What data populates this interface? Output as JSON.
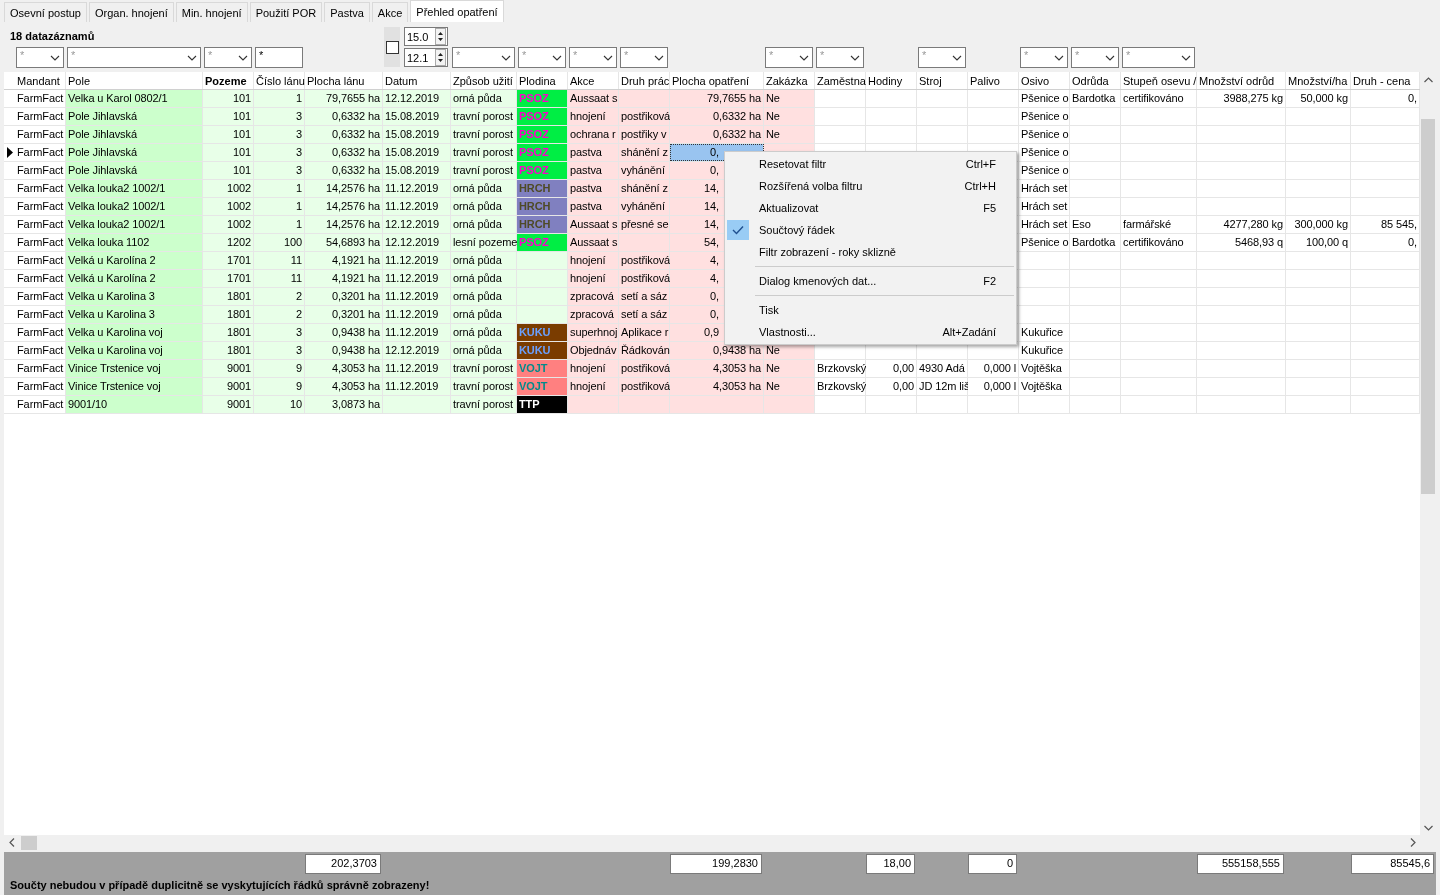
{
  "tabs": [
    {
      "label": "Osevní postup",
      "selected": false
    },
    {
      "label": "Organ. hnojení",
      "selected": false
    },
    {
      "label": "Min. hnojení",
      "selected": false
    },
    {
      "label": "Použití POR",
      "selected": false
    },
    {
      "label": "Pastva",
      "selected": false
    },
    {
      "label": "Akce",
      "selected": false
    },
    {
      "label": "Přehled opatření",
      "selected": true
    }
  ],
  "grid": {
    "record_count": "18 datazáznamů",
    "columns": [
      {
        "label": "Mandant",
        "kind": "text",
        "color": "#ffffff",
        "sorted": false,
        "focused": false,
        "filter": {
          "kind": "dropdown",
          "value": "*"
        }
      },
      {
        "label": "Pole",
        "kind": "text",
        "color": "#ccffcc",
        "sorted": false,
        "focused": false,
        "filter": {
          "kind": "dropdown",
          "value": "*"
        }
      },
      {
        "label": "Pozeme",
        "kind": "number",
        "color": "#e8ffe8",
        "sorted": true,
        "focused": false,
        "filter": {
          "kind": "dropdown",
          "value": "*"
        }
      },
      {
        "label": "Číslo lánu",
        "kind": "number",
        "color": "#e8ffe8",
        "sorted": false,
        "focused": false,
        "filter": {
          "kind": "text",
          "value": "*"
        }
      },
      {
        "label": "Plocha lánu",
        "kind": "number",
        "color": "#e8ffe8",
        "sorted": false,
        "focused": false,
        "total": "202,3703"
      },
      {
        "label": "Datum",
        "kind": "text",
        "color": "#e8ffe8",
        "sorted": false,
        "focused": false,
        "filter": {
          "kind": "date_range",
          "checked": false,
          "from": "15.0",
          "to": "12.1"
        }
      },
      {
        "label": "Způsob užití",
        "kind": "text",
        "color": "#e8ffe8",
        "sorted": false,
        "focused": false,
        "filter": {
          "kind": "dropdown",
          "value": "*"
        }
      },
      {
        "label": "Plodina",
        "kind": "tag",
        "color": "#e8ffe8",
        "sorted": false,
        "focused": false,
        "filter": {
          "kind": "dropdown",
          "value": "*"
        }
      },
      {
        "label": "Akce",
        "kind": "text",
        "color": "#ffe0e0",
        "sorted": false,
        "focused": false,
        "filter": {
          "kind": "dropdown",
          "value": "*"
        }
      },
      {
        "label": "Druh prác",
        "kind": "text",
        "color": "#ffe0e0",
        "sorted": false,
        "focused": false,
        "filter": {
          "kind": "dropdown",
          "value": "*"
        }
      },
      {
        "label": "Plocha opatření",
        "kind": "number",
        "color": "#ffe0e0",
        "sorted": false,
        "focused": true,
        "total": "199,2830"
      },
      {
        "label": "Zakázka",
        "kind": "text",
        "color": "#ffe0e0",
        "sorted": false,
        "focused": false,
        "filter": {
          "kind": "dropdown",
          "value": "*"
        }
      },
      {
        "label": "Zaměstna",
        "kind": "text",
        "color": "#ffffff",
        "sorted": false,
        "focused": false,
        "filter": {
          "kind": "dropdown",
          "value": "*"
        }
      },
      {
        "label": "Hodiny",
        "kind": "number",
        "color": "#ffffff",
        "sorted": false,
        "focused": false,
        "total": "18,00"
      },
      {
        "label": "Stroj",
        "kind": "text",
        "color": "#ffffff",
        "sorted": false,
        "focused": false,
        "filter": {
          "kind": "dropdown",
          "value": "*"
        }
      },
      {
        "label": "Palivo",
        "kind": "number",
        "color": "#ffffff",
        "sorted": false,
        "focused": false,
        "total": "0"
      },
      {
        "label": "Osivo",
        "kind": "text",
        "color": "#ffffff",
        "sorted": false,
        "focused": false,
        "filter": {
          "kind": "dropdown",
          "value": "*"
        }
      },
      {
        "label": "Odrůda",
        "kind": "text",
        "color": "#ffffff",
        "sorted": false,
        "focused": false,
        "filter": {
          "kind": "dropdown",
          "value": "*"
        }
      },
      {
        "label": "Stupeň osevu /",
        "kind": "text",
        "color": "#ffffff",
        "sorted": false,
        "focused": false,
        "filter": {
          "kind": "dropdown",
          "value": "*"
        }
      },
      {
        "label": "Množství odrůd",
        "kind": "number",
        "color": "#ffffff",
        "sorted": false,
        "focused": false,
        "total": "555158,555"
      },
      {
        "label": "Množství/ha",
        "kind": "number",
        "color": "#ffffff",
        "sorted": false,
        "focused": false
      },
      {
        "label": "Druh - cena",
        "kind": "number",
        "color": "#ffffff",
        "sorted": false,
        "focused": false,
        "total": "85545,6"
      }
    ],
    "rows": [
      {
        "selected": false,
        "under_menu": false,
        "cells": [
          "FarmFact",
          "Velka u Karol 0802/1",
          "101",
          "1",
          "79,7655 ha",
          "12.12.2019",
          "orná půda",
          {
            "color": "#00ee44",
            "code": {
              "text": "PSOZ",
              "color": "#ff00cc"
            }
          },
          "Aussaat s",
          null,
          "79,7655 ha",
          "Ne",
          null,
          null,
          null,
          null,
          "Pšenice o",
          "Bardotka",
          "certifikováno",
          "3988,275 kg",
          "50,000 kg",
          "0,"
        ]
      },
      {
        "selected": false,
        "under_menu": false,
        "cells": [
          "FarmFact",
          "Pole Jihlavská",
          "101",
          "3",
          "0,6332 ha",
          "15.08.2019",
          "travní porost",
          {
            "color": "#00ee44",
            "code": {
              "text": "PSOZ",
              "color": "#ff00cc"
            }
          },
          "hnojení",
          "postřiková",
          "0,6332 ha",
          "Ne",
          null,
          null,
          null,
          null,
          "Pšenice o",
          null,
          null,
          null,
          null,
          null
        ]
      },
      {
        "selected": false,
        "under_menu": false,
        "cells": [
          "FarmFact",
          "Pole Jihlavská",
          "101",
          "3",
          "0,6332 ha",
          "15.08.2019",
          "travní porost",
          {
            "color": "#00ee44",
            "code": {
              "text": "PSOZ",
              "color": "#ff00cc"
            }
          },
          "ochrana r",
          "postřiky v",
          "0,6332 ha",
          "Ne",
          null,
          null,
          null,
          null,
          "Pšenice o",
          null,
          null,
          null,
          null,
          null
        ]
      },
      {
        "selected": true,
        "under_menu": true,
        "cells": [
          "FarmFact",
          "Pole Jihlavská",
          "101",
          "3",
          "0,6332 ha",
          "15.08.2019",
          "travní porost",
          {
            "color": "#00ee44",
            "code": {
              "text": "PSOZ",
              "color": "#ff00cc"
            }
          },
          "pastva",
          "shánění z",
          "0,",
          null,
          null,
          null,
          null,
          null,
          "Pšenice o",
          null,
          null,
          null,
          null,
          null
        ]
      },
      {
        "selected": false,
        "under_menu": true,
        "cells": [
          "FarmFact",
          "Pole Jihlavská",
          "101",
          "3",
          "0,6332 ha",
          "15.08.2019",
          "travní porost",
          {
            "color": "#00ee44",
            "code": {
              "text": "PSOZ",
              "color": "#ff00cc"
            }
          },
          "pastva",
          "vyhánění",
          "0,",
          null,
          null,
          null,
          null,
          null,
          "Pšenice o",
          null,
          null,
          null,
          null,
          null
        ]
      },
      {
        "selected": false,
        "under_menu": true,
        "cells": [
          "FarmFact",
          "Velka louka2 1002/1",
          "1002",
          "1",
          "14,2576 ha",
          "11.12.2019",
          "orná půda",
          {
            "color": "#8080c0",
            "code": {
              "text": "HRCH",
              "color": "#4e4a26"
            }
          },
          "pastva",
          "shánění z",
          "14,",
          null,
          null,
          null,
          null,
          null,
          "Hrách set",
          null,
          null,
          null,
          null,
          null
        ]
      },
      {
        "selected": false,
        "under_menu": true,
        "cells": [
          "FarmFact",
          "Velka louka2 1002/1",
          "1002",
          "1",
          "14,2576 ha",
          "11.12.2019",
          "orná půda",
          {
            "color": "#8080c0",
            "code": {
              "text": "HRCH",
              "color": "#4e4a26"
            }
          },
          "pastva",
          "vyhánění",
          "14,",
          null,
          null,
          null,
          null,
          null,
          "Hrách set",
          null,
          null,
          null,
          null,
          null
        ]
      },
      {
        "selected": false,
        "under_menu": true,
        "cells": [
          "FarmFact",
          "Velka louka2 1002/1",
          "1002",
          "1",
          "14,2576 ha",
          "12.12.2019",
          "orná půda",
          {
            "color": "#8080c0",
            "code": {
              "text": "HRCH",
              "color": "#4e4a26"
            }
          },
          "Aussaat s",
          "přesné se",
          "14,",
          null,
          null,
          null,
          null,
          null,
          "Hrách set",
          "Eso",
          "farmářské",
          "4277,280 kg",
          "300,000 kg",
          "85 545,"
        ]
      },
      {
        "selected": false,
        "under_menu": true,
        "cells": [
          "FarmFact",
          "Velka louka 1102",
          "1202",
          "100",
          "54,6893 ha",
          "12.12.2019",
          "lesní pozeme",
          {
            "color": "#00ee44",
            "code": {
              "text": "PSOZ",
              "color": "#ff00cc"
            }
          },
          "Aussaat s",
          null,
          "54,",
          null,
          null,
          null,
          null,
          null,
          "Pšenice o",
          "Bardotka",
          "certifikováno",
          "5468,93 q",
          "100,00 q",
          "0,"
        ]
      },
      {
        "selected": false,
        "under_menu": true,
        "cells": [
          "FarmFact",
          "Velká u Karolína 2",
          "1701",
          "11",
          "4,1921 ha",
          "11.12.2019",
          "orná půda",
          null,
          "hnojení",
          "postřiková",
          "4,",
          null,
          null,
          null,
          null,
          null,
          null,
          null,
          null,
          null,
          null,
          null
        ]
      },
      {
        "selected": false,
        "under_menu": true,
        "cells": [
          "FarmFact",
          "Velká u Karolína 2",
          "1701",
          "11",
          "4,1921 ha",
          "11.12.2019",
          "orná půda",
          null,
          "hnojení",
          "postřiková",
          "4,",
          null,
          null,
          null,
          null,
          null,
          null,
          null,
          null,
          null,
          null,
          null
        ]
      },
      {
        "selected": false,
        "under_menu": true,
        "cells": [
          "FarmFact",
          "Velka u Karolina 3",
          "1801",
          "2",
          "0,3201 ha",
          "11.12.2019",
          "orná půda",
          null,
          "zpracová",
          "setí a sáz",
          "0,",
          null,
          null,
          null,
          null,
          null,
          null,
          null,
          null,
          null,
          null,
          null
        ]
      },
      {
        "selected": false,
        "under_menu": true,
        "cells": [
          "FarmFact",
          "Velka u Karolina 3",
          "1801",
          "2",
          "0,3201 ha",
          "11.12.2019",
          "orná půda",
          null,
          "zpracová",
          "setí a sáz",
          "0,",
          null,
          null,
          null,
          null,
          null,
          null,
          null,
          null,
          null,
          null,
          null
        ]
      },
      {
        "selected": false,
        "under_menu": true,
        "cells": [
          "FarmFact",
          "Velka u Karolina voj",
          "1801",
          "3",
          "0,9438 ha",
          "11.12.2019",
          "orná půda",
          {
            "color": "#7a3c00",
            "code": {
              "text": "KUKU",
              "color": "#6aa0ff"
            }
          },
          "superhnoj",
          "Aplikace r",
          "0,9",
          null,
          null,
          null,
          null,
          null,
          "Kukuřice",
          null,
          null,
          null,
          null,
          null
        ]
      },
      {
        "selected": false,
        "under_menu": false,
        "cells": [
          "FarmFact",
          "Velka u Karolina voj",
          "1801",
          "3",
          "0,9438 ha",
          "12.12.2019",
          "orná půda",
          {
            "color": "#7a3c00",
            "code": {
              "text": "KUKU",
              "color": "#6aa0ff"
            }
          },
          "Objednáv",
          "Řádkován",
          "0,9438 ha",
          "Ne",
          null,
          null,
          null,
          null,
          "Kukuřice",
          null,
          null,
          null,
          null,
          null
        ]
      },
      {
        "selected": false,
        "under_menu": false,
        "cells": [
          "FarmFact",
          "Vinice Trstenice voj",
          "9001",
          "9",
          "4,3053 ha",
          "11.12.2019",
          "travní porost",
          {
            "color": "#ff8080",
            "code": {
              "text": "VOJT",
              "color": "#008b8b"
            }
          },
          "hnojení",
          "postřiková",
          "4,3053 ha",
          "Ne",
          "Brzkovský",
          "0,00",
          "4930 Adá",
          "0,000 l",
          "Vojtěška",
          null,
          null,
          null,
          null,
          null
        ]
      },
      {
        "selected": false,
        "under_menu": false,
        "cells": [
          "FarmFact",
          "Vinice Trstenice voj",
          "9001",
          "9",
          "4,3053 ha",
          "11.12.2019",
          "travní porost",
          {
            "color": "#ff8080",
            "code": {
              "text": "VOJT",
              "color": "#008b8b"
            }
          },
          "hnojení",
          "postřiková",
          "4,3053 ha",
          "Ne",
          "Brzkovský",
          "0,00",
          "JD 12m liš",
          "0,000 l",
          "Vojtěška",
          null,
          null,
          null,
          null,
          null
        ]
      },
      {
        "selected": false,
        "cells": [
          "FarmFact",
          "9001/10",
          "9001",
          "10",
          "3,0873 ha",
          null,
          "travní porost",
          {
            "color": "#000000",
            "code": {
              "text": "TTP",
              "color": "#ffffff"
            }
          },
          null,
          null,
          null,
          null,
          null,
          null,
          null,
          null,
          null,
          null,
          null,
          null,
          null,
          null
        ]
      }
    ]
  },
  "context_menu": {
    "items": [
      {
        "kind": "item",
        "label": "Resetovat filtr",
        "shortcut": "Ctrl+F",
        "checked": false
      },
      {
        "kind": "item",
        "label": "Rozšířená volba filtru",
        "shortcut": "Ctrl+H",
        "checked": false
      },
      {
        "kind": "item",
        "label": "Aktualizovat",
        "shortcut": "F5",
        "checked": false
      },
      {
        "kind": "item",
        "label": "Součtový řádek",
        "checked": true
      },
      {
        "kind": "item",
        "label": "Filtr zobrazení - roky sklizně",
        "checked": false
      },
      {
        "kind": "separator"
      },
      {
        "kind": "item",
        "label": "Dialog kmenových dat...",
        "shortcut": "F2",
        "checked": false
      },
      {
        "kind": "separator"
      },
      {
        "kind": "item",
        "label": "Tisk",
        "checked": false
      },
      {
        "kind": "item",
        "label": "Vlastnosti...",
        "shortcut": "Alt+Zadání",
        "checked": false
      }
    ]
  },
  "footer": {
    "warning": "Součty nebudou v případě duplicitně se vyskytujících řádků správně zobrazeny!"
  }
}
